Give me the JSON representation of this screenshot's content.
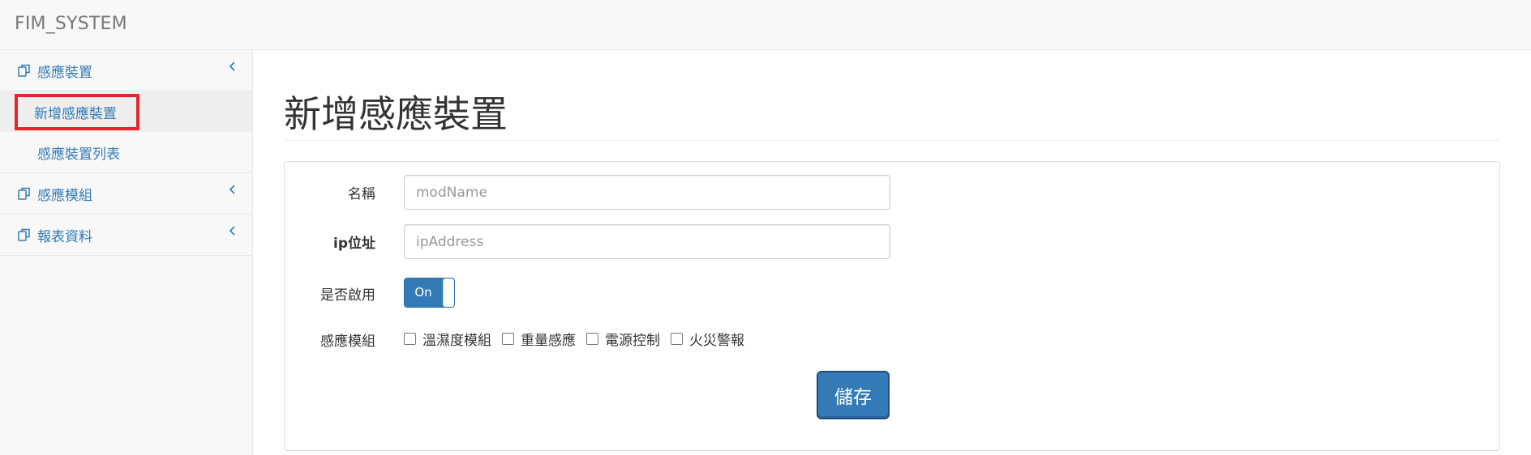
{
  "app": {
    "brand": "FIM_SYSTEM"
  },
  "sidebar": {
    "groups": [
      {
        "label": "感應裝置",
        "icon": "copy-icon",
        "expanded": true,
        "items": [
          {
            "label": "新增感應裝置",
            "active": true
          },
          {
            "label": "感應裝置列表",
            "active": false
          }
        ]
      },
      {
        "label": "感應模組",
        "icon": "copy-icon",
        "expanded": false
      },
      {
        "label": "報表資料",
        "icon": "copy-icon",
        "expanded": false
      }
    ]
  },
  "main": {
    "title": "新增感應裝置",
    "form": {
      "name_label": "名稱",
      "name_placeholder": "modName",
      "ip_label": "ip位址",
      "ip_placeholder": "ipAddress",
      "enable_label": "是否啟用",
      "enable_toggle": "On",
      "modules_label": "感應模組",
      "modules": [
        {
          "label": "溫濕度模組",
          "checked": false
        },
        {
          "label": "重量感應",
          "checked": false
        },
        {
          "label": "電源控制",
          "checked": false
        },
        {
          "label": "火災警報",
          "checked": false
        }
      ],
      "save_label": "儲存"
    }
  },
  "colors": {
    "link": "#337ab7",
    "primary": "#337ab7",
    "highlight": "#e3262c",
    "navbar_bg": "#f8f8f8"
  }
}
